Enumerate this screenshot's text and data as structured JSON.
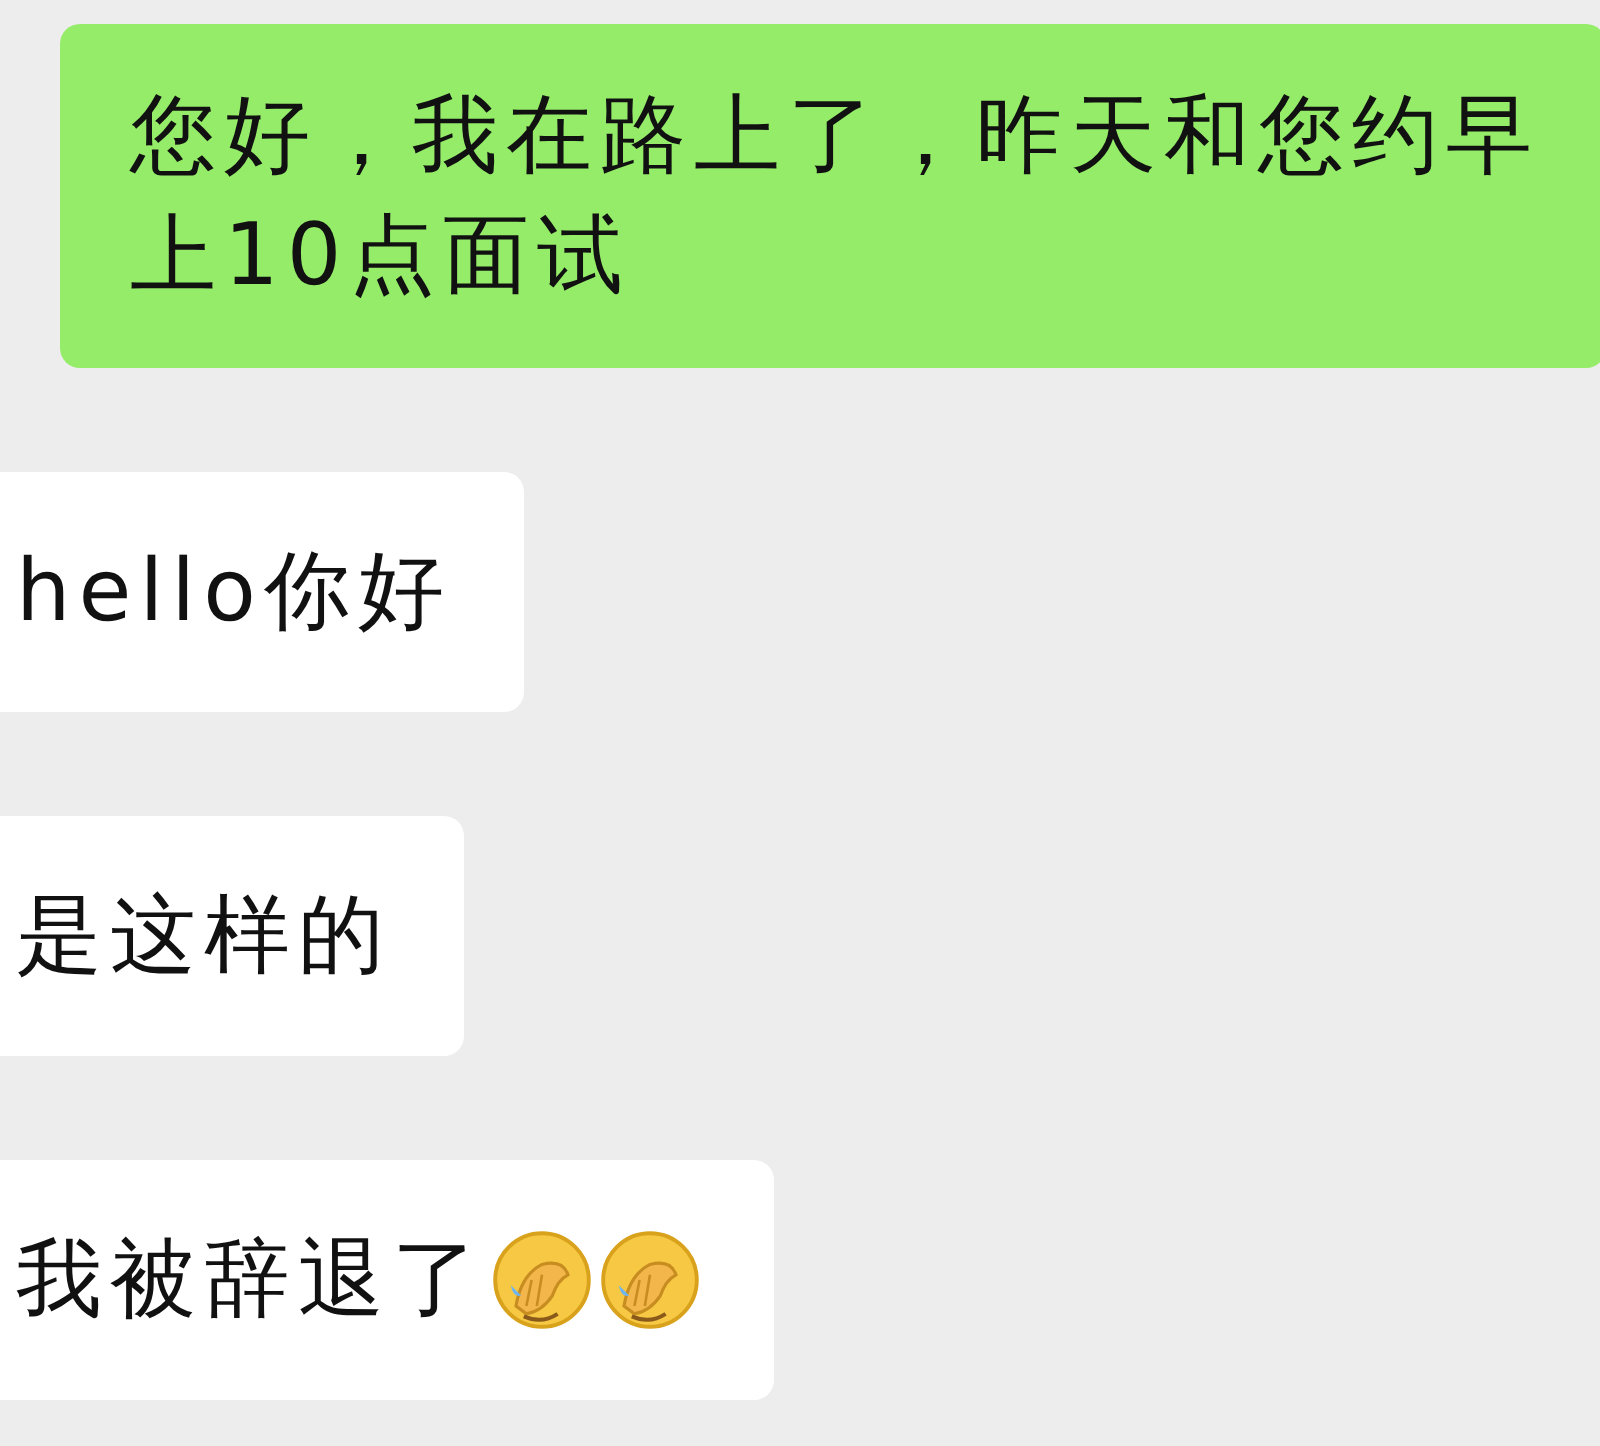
{
  "messages": [
    {
      "kind": "sent",
      "text": "您好，我在路上了，昨天和您约早上10点面试"
    },
    {
      "kind": "received",
      "text": "hello你好"
    },
    {
      "kind": "received",
      "text": "是这样的"
    },
    {
      "kind": "received",
      "text": "我被辞退了",
      "emojis": [
        {
          "kind": "facepalm"
        },
        {
          "kind": "facepalm"
        }
      ]
    }
  ]
}
